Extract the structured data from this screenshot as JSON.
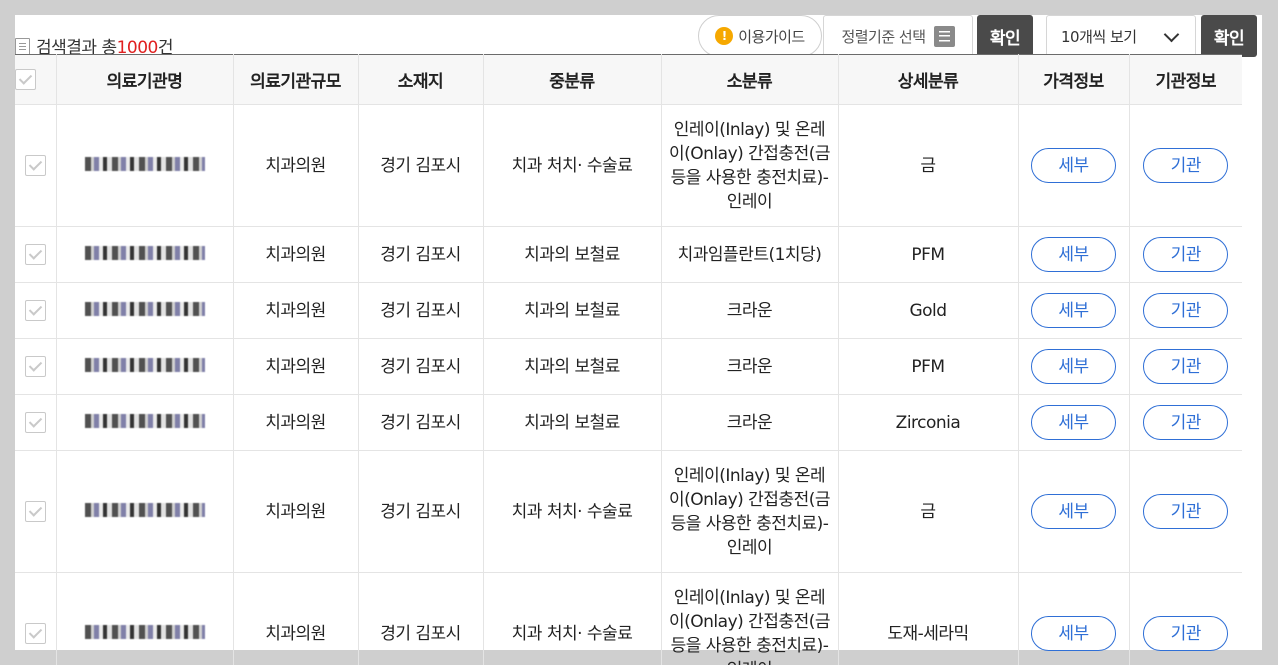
{
  "summary": {
    "prefix": "검색결과 총",
    "count": "1000",
    "suffix": "건"
  },
  "toolbar": {
    "guide_label": "이용가이드",
    "sort_label": "정렬기준 선택",
    "confirm_label": "확인",
    "page_size_value": "10개씩 보기",
    "confirm2_label": "확인"
  },
  "table": {
    "headers": [
      "의료기관명",
      "의료기관규모",
      "소재지",
      "중분류",
      "소분류",
      "상세분류",
      "가격정보",
      "기관정보"
    ],
    "rows": [
      {
        "size": "치과의원",
        "location": "경기 김포시",
        "mid": "치과 처치· 수술료",
        "small": "인레이(Inlay) 및 온레이(Onlay) 간접충전(금 등을 사용한 충전치료)-인레이",
        "detail": "금",
        "price_btn": "세부",
        "org_btn": "기관"
      },
      {
        "size": "치과의원",
        "location": "경기 김포시",
        "mid": "치과의 보철료",
        "small": "치과임플란트(1치당)",
        "detail": "PFM",
        "price_btn": "세부",
        "org_btn": "기관"
      },
      {
        "size": "치과의원",
        "location": "경기 김포시",
        "mid": "치과의 보철료",
        "small": "크라운",
        "detail": "Gold",
        "price_btn": "세부",
        "org_btn": "기관"
      },
      {
        "size": "치과의원",
        "location": "경기 김포시",
        "mid": "치과의 보철료",
        "small": "크라운",
        "detail": "PFM",
        "price_btn": "세부",
        "org_btn": "기관"
      },
      {
        "size": "치과의원",
        "location": "경기 김포시",
        "mid": "치과의 보철료",
        "small": "크라운",
        "detail": "Zirconia",
        "price_btn": "세부",
        "org_btn": "기관"
      },
      {
        "size": "치과의원",
        "location": "경기 김포시",
        "mid": "치과 처치· 수술료",
        "small": "인레이(Inlay) 및 온레이(Onlay) 간접충전(금 등을 사용한 충전치료)-인레이",
        "detail": "금",
        "price_btn": "세부",
        "org_btn": "기관"
      },
      {
        "size": "치과의원",
        "location": "경기 김포시",
        "mid": "치과 처치· 수술료",
        "small": "인레이(Inlay) 및 온레이(Onlay) 간접충전(금 등을 사용한 충전치료)-인레이",
        "detail": "도재-세라믹",
        "price_btn": "세부",
        "org_btn": "기관"
      }
    ]
  }
}
